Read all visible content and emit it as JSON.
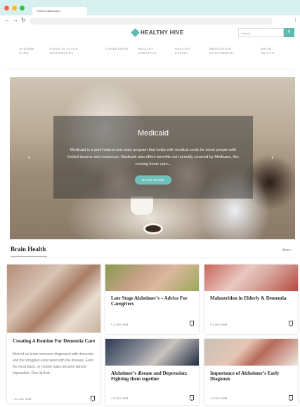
{
  "browser": {
    "tab_title": "Partner Dashboard",
    "back_icon": "arrow-left",
    "forward_icon": "arrow-right",
    "reload_icon": "reload",
    "menu_icon": "kebab"
  },
  "header": {
    "logo_text": "HEALTHY HIVE",
    "search_placeholder": "Search..."
  },
  "menu": {
    "items": [
      {
        "line1": "IN-HOME",
        "line2": "CARE"
      },
      {
        "line1": "AGING IN PLACE",
        "line2": "TECHNOLOGY"
      },
      {
        "line1": "CAREGIVERS",
        "line2": ""
      },
      {
        "line1": "HEALTHY",
        "line2": "LIFESTYLE"
      },
      {
        "line1": "HEALTHY",
        "line2": "EATING"
      },
      {
        "line1": "MEDICATION",
        "line2": "MANAGEMENT"
      },
      {
        "line1": "BRAIN",
        "line2": "HEALTH"
      }
    ]
  },
  "hero": {
    "title": "Medicaid",
    "text": "Medicaid is a joint federal and state program that helps with medical costs for some people with limited income and resources. Medicaid also offers benefits not normally covered by Medicare, like nursing home care...",
    "button_label": "READ MORE"
  },
  "section": {
    "title": "Brain Health",
    "more_label": "More  ›"
  },
  "cards": [
    {
      "title": "Creating A Routine For Dementia Care",
      "desc": "Most of us know someone diagnosed with dementia and the struggles associated with the disease. Even the most basic, or routine tasks become almost impossible. One tip that...",
      "read": "• 31 sec read"
    },
    {
      "title": "Late Stage Alzheimer’s – Advice For Caregivers",
      "desc": "",
      "read": "• 2 min read"
    },
    {
      "title": "Malnutrition in Elderly & Dementia",
      "desc": "",
      "read": "• 2 min read"
    },
    {
      "title": "Alzheimer’s disease and Depression: Fighting them together",
      "desc": "",
      "read": "• 3 min read"
    },
    {
      "title": "Importance of Alzheimer’s Early Diagnosis",
      "desc": "",
      "read": "• 2 min read"
    }
  ],
  "colors": {
    "accent": "#5fb8b2",
    "chrome": "#d6f0f0"
  }
}
